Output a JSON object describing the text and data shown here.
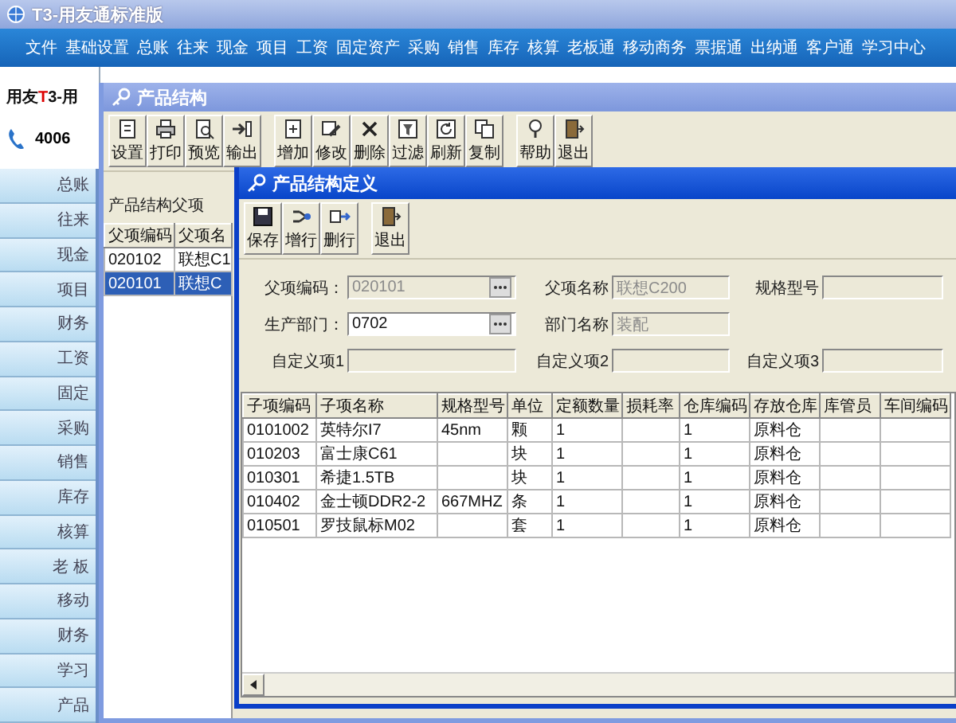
{
  "app_window": {
    "title": "T3-用友通标准版"
  },
  "menu_bar": [
    "文件",
    "基础设置",
    "总账",
    "往来",
    "现金",
    "项目",
    "工资",
    "固定资产",
    "采购",
    "销售",
    "库存",
    "核算",
    "老板通",
    "移动商务",
    "票据通",
    "出纳通",
    "客户通",
    "学习中心"
  ],
  "sidebar": {
    "brand": "用友",
    "brand_mark": "T",
    "brand_tail": "3-用",
    "phone": "4006",
    "items": [
      "总账",
      "往来",
      "现金",
      "项目",
      "财务",
      "工资",
      "固定",
      "采购",
      "销售",
      "库存",
      "核算",
      "老 板",
      "移动",
      "财务",
      "学习",
      "产品"
    ]
  },
  "product_structure_window": {
    "title": "产品结构",
    "toolbar": [
      [
        "设置",
        "打印",
        "预览",
        "输出"
      ],
      [
        "增加",
        "修改",
        "删除",
        "过滤",
        "刷新",
        "复制"
      ],
      [
        "帮助",
        "退出"
      ]
    ],
    "parent_list": {
      "title": "产品结构父项",
      "columns": [
        "父项编码",
        "父项名"
      ],
      "rows": [
        {
          "code": "020102",
          "name": "联想C1",
          "selected": false
        },
        {
          "code": "020101",
          "name": "联想C",
          "selected": true
        }
      ]
    }
  },
  "definition_window": {
    "title": "产品结构定义",
    "toolbar": [
      [
        "保存",
        "增行",
        "删行"
      ],
      [
        "退出"
      ]
    ],
    "form_rows": [
      {
        "fields": [
          {
            "label": "父项编码：",
            "value": "020101",
            "kind": "lookup",
            "disabled": true
          },
          {
            "label": "父项名称",
            "value": "联想C200",
            "kind": "text",
            "disabled": true
          },
          {
            "label": "规格型号",
            "kind": "text",
            "disabled": true
          }
        ]
      },
      {
        "fields": [
          {
            "label": "生产部门：",
            "value": "0702",
            "kind": "lookup",
            "disabled": false
          },
          {
            "label": "部门名称",
            "value": "装配",
            "kind": "text",
            "disabled": true
          }
        ]
      },
      {
        "fields": [
          {
            "label": "自定义项1",
            "kind": "text",
            "disabled": true
          },
          {
            "label": "自定义项2",
            "kind": "text",
            "disabled": true
          },
          {
            "label": "自定义项3",
            "kind": "text",
            "disabled": true
          }
        ]
      }
    ],
    "table": {
      "columns": [
        "子项编码",
        "子项名称",
        "规格型号",
        "单位",
        "定额数量",
        "损耗率",
        "仓库编码",
        "存放仓库",
        "库管员",
        "车间编码"
      ],
      "rows": [
        {
          "code": "0101002",
          "name": "英特尔I7",
          "spec": "45nm",
          "unit": "颗",
          "quantity": "1",
          "warehouse_code": "1",
          "warehouse": "原料仓"
        },
        {
          "code": "010203",
          "name": "富士康C61",
          "unit": "块",
          "quantity": "1",
          "warehouse_code": "1",
          "warehouse": "原料仓"
        },
        {
          "code": "010301",
          "name": "希捷1.5TB",
          "unit": "块",
          "quantity": "1",
          "warehouse_code": "1",
          "warehouse": "原料仓"
        },
        {
          "code": "010402",
          "name": "金士顿DDR2-2",
          "spec": "667MHZ",
          "unit": "条",
          "quantity": "1",
          "warehouse_code": "1",
          "warehouse": "原料仓"
        },
        {
          "code": "010501",
          "name": "罗技鼠标M02",
          "unit": "套",
          "quantity": "1",
          "warehouse_code": "1",
          "warehouse": "原料仓"
        }
      ]
    }
  }
}
